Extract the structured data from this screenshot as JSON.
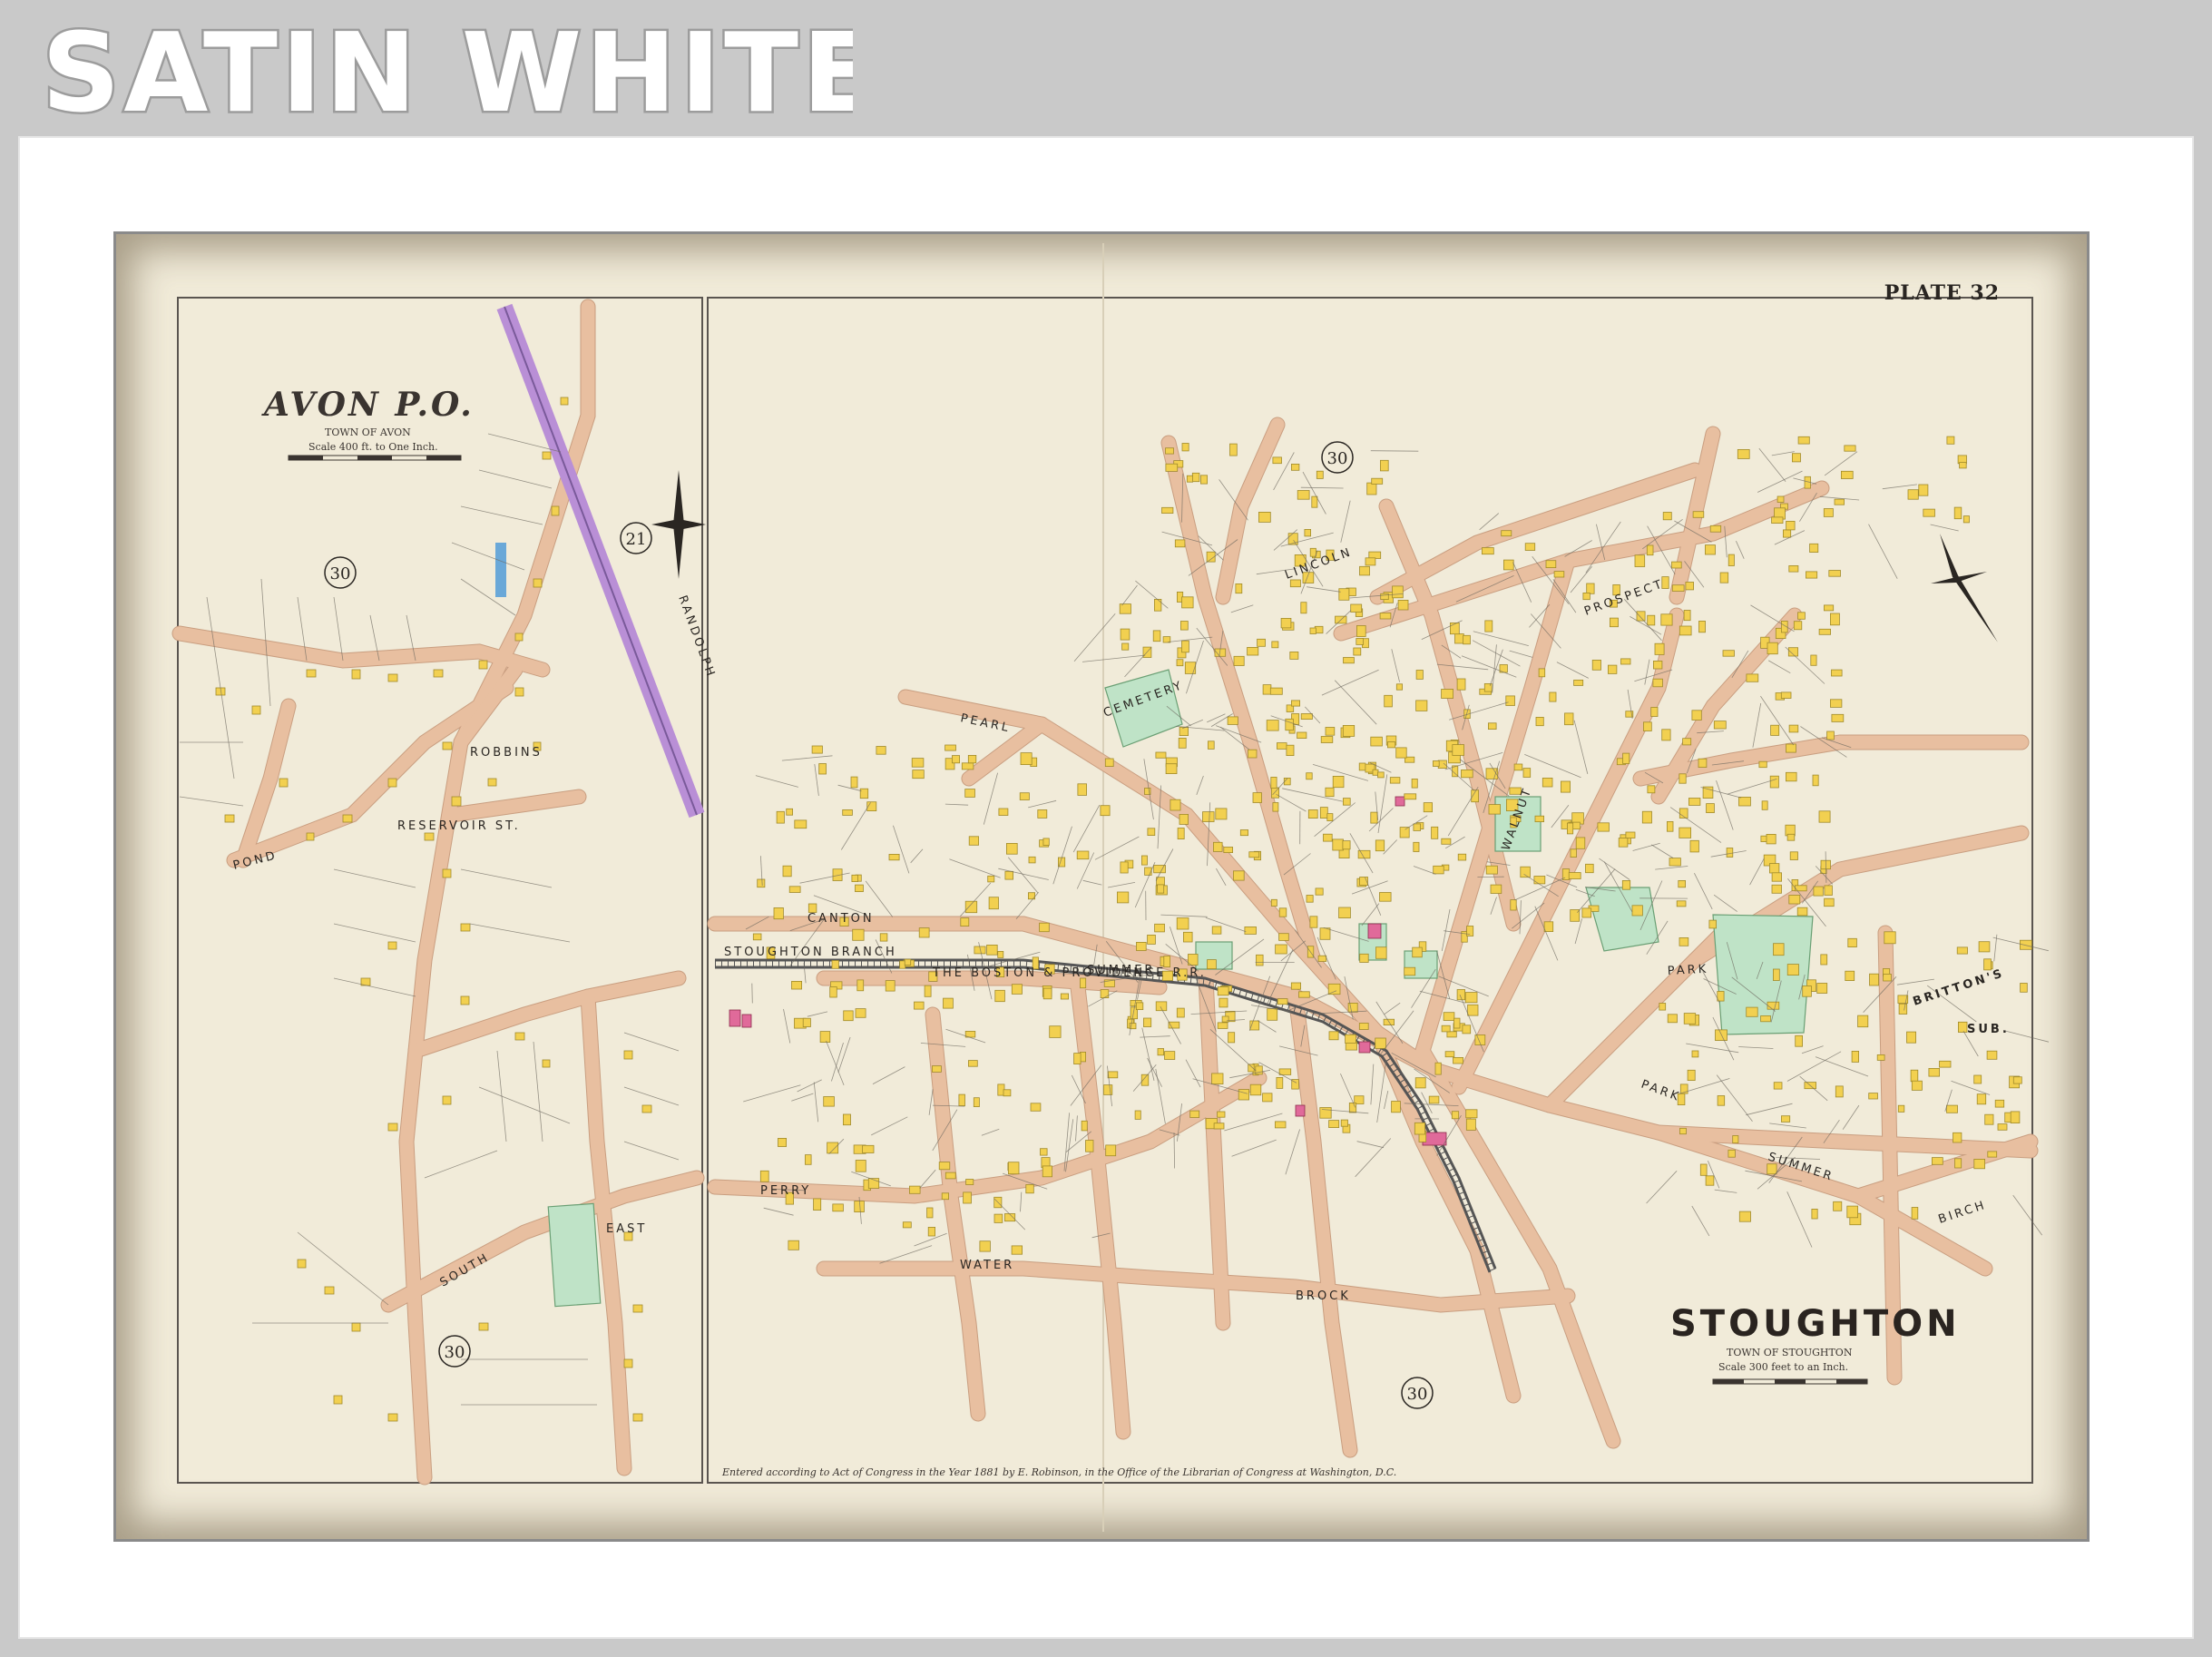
{
  "banner": {
    "text": "SATIN WHITE"
  },
  "map": {
    "plate": "PLATE 32",
    "avon": {
      "title": "AVON P.O.",
      "town": "TOWN OF AVON",
      "scale": "Scale 400 ft. to One Inch.",
      "sheet_refs": [
        "30",
        "21",
        "30"
      ]
    },
    "stoughton": {
      "title": "STOUGHTON",
      "town": "TOWN OF STOUGHTON",
      "scale": "Scale 300 feet to an Inch.",
      "sheet_refs": [
        "30",
        "30"
      ]
    },
    "places": {
      "park": "PARK",
      "cemetery": "CEMETERY",
      "britton": "BRITTON'S",
      "sub": "SUB."
    },
    "streets": {
      "randolph": "RANDOLPH",
      "pearl": "PEARL",
      "canton": "CANTON",
      "summer": "SUMMER",
      "perry": "PERRY",
      "water": "WATER",
      "prospect": "PROSPECT",
      "park_st": "PARK",
      "summer_e": "SUMMER",
      "east_st": "EAST",
      "pond": "POND",
      "brock": "BROCK",
      "lincoln": "LINCOLN",
      "walnut": "WALNUT",
      "reservoir": "RESERVOIR ST.",
      "robbins": "ROBBINS",
      "south": "SOUTH",
      "birch": "BIRCH",
      "stoughton_branch": "STOUGHTON BRANCH",
      "boston_providence": "THE BOSTON & PROVIDENCE R.R."
    },
    "footer_note": "Entered according to Act of Congress in the Year 1881 by E. Robinson, in the Office of the Librarian of Congress at Washington, D.C."
  },
  "colors": {
    "paper": "#f1ebd9",
    "roads": "#e8bfa0",
    "buildings": "#f2d050",
    "parks": "#bfe3c7",
    "rail_line": "#b98fd6"
  }
}
